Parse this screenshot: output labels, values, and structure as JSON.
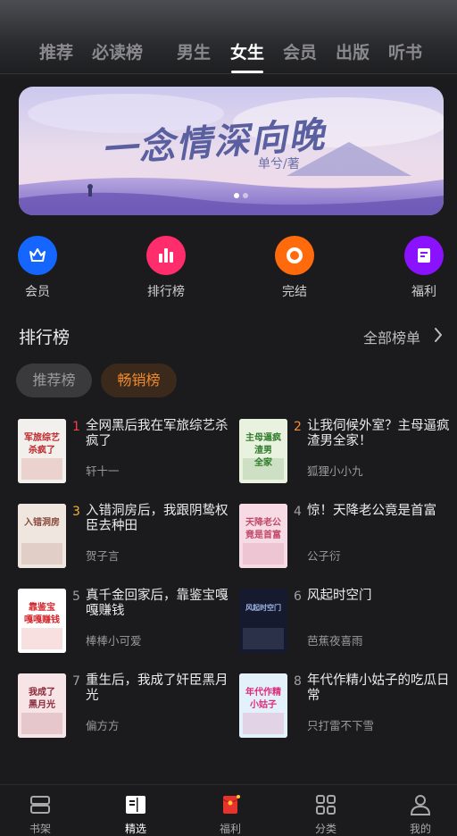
{
  "tabs": [
    "推荐",
    "必读榜",
    "男生",
    "女生",
    "会员",
    "出版",
    "听书"
  ],
  "active_tab": "女生",
  "banner": {
    "title": "一念情深向晚",
    "author": "单兮/著",
    "dot_count": 2,
    "active_dot": 0
  },
  "quick_links": [
    {
      "label": "会员",
      "icon": "crown-icon",
      "color": "#1565ff"
    },
    {
      "label": "排行榜",
      "icon": "bar-chart-icon",
      "color": "#ff2d6b"
    },
    {
      "label": "完结",
      "icon": "ring-icon",
      "color": "#ff6a0d"
    },
    {
      "label": "福利",
      "icon": "bookmark-page-icon",
      "color": "#8a12ff"
    }
  ],
  "section": {
    "title": "排行榜",
    "more": "全部榜单",
    "pills": [
      "推荐榜",
      "畅销榜"
    ],
    "active_pill": "畅销榜"
  },
  "books": [
    {
      "rank": "1",
      "title": "全网黑后我在军旅综艺杀疯了",
      "author": "轩十一",
      "rank_color": "#ff3b4b",
      "cover_text": "军旅综艺 杀疯了",
      "cover_bg": "#f2f0ec",
      "cover_fg": "#c0262b"
    },
    {
      "rank": "2",
      "title": "让我伺候外室？主母逼疯渣男全家！",
      "author": "狐狸小小九",
      "rank_color": "#ff8a2c",
      "cover_text": "主母逼疯 渣男 全家",
      "cover_bg": "#e9f2df",
      "cover_fg": "#2f7a2a"
    },
    {
      "rank": "3",
      "title": "入错洞房后，我跟阴鸷权臣去种田",
      "author": "贺子言",
      "rank_color": "#f0b43a",
      "cover_text": "入错洞房",
      "cover_bg": "#efe6e0",
      "cover_fg": "#8a4a3a"
    },
    {
      "rank": "4",
      "title": "惊！天降老公竟是首富",
      "author": "公子衍",
      "rank_color": "#a0a0a2",
      "cover_text": "天降老公 竟是首富",
      "cover_bg": "#f6dbe4",
      "cover_fg": "#c2486a"
    },
    {
      "rank": "5",
      "title": "真千金回家后，靠鉴宝嘎嘎赚钱",
      "author": "棒棒小可爱",
      "rank_color": "#a0a0a2",
      "cover_text": "靠鉴宝 嘎嘎赚钱",
      "cover_bg": "#ffffff",
      "cover_fg": "#d2282e"
    },
    {
      "rank": "6",
      "title": "风起时空门",
      "author": "芭蕉夜喜雨",
      "rank_color": "#a0a0a2",
      "cover_text": "风起时空门",
      "cover_bg": "#161a2e",
      "cover_fg": "#9fb4e6"
    },
    {
      "rank": "7",
      "title": "重生后，我成了奸臣黑月光",
      "author": "偏方方",
      "rank_color": "#a0a0a2",
      "cover_text": "我成了 黑月光",
      "cover_bg": "#f6e4e6",
      "cover_fg": "#8a2a3a"
    },
    {
      "rank": "8",
      "title": "年代作精小姑子的吃瓜日常",
      "author": "只打雷不下雪",
      "rank_color": "#a0a0a2",
      "cover_text": "年代作精 小姑子",
      "cover_bg": "#e3f1fb",
      "cover_fg": "#e0287a"
    }
  ],
  "bottom_nav": [
    {
      "label": "书架",
      "icon": "bookshelf-icon"
    },
    {
      "label": "精选",
      "icon": "book-open-icon"
    },
    {
      "label": "福利",
      "icon": "red-envelope-icon"
    },
    {
      "label": "分类",
      "icon": "grid-icon"
    },
    {
      "label": "我的",
      "icon": "user-icon"
    }
  ],
  "active_nav": "精选"
}
